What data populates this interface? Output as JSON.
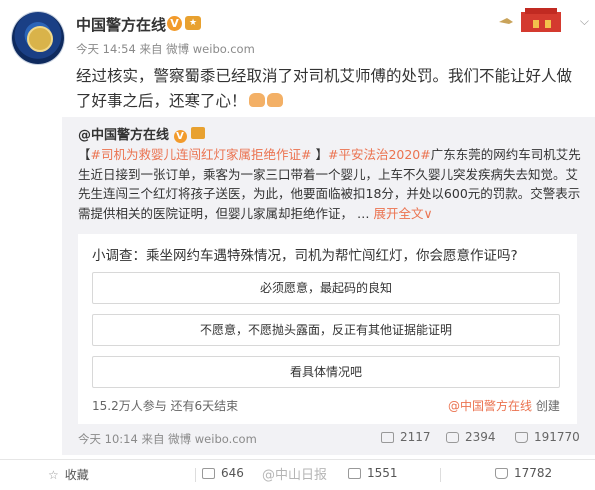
{
  "post": {
    "author": "中国警方在线",
    "verified_badge": "V",
    "meta": "今天 14:54 来自 微博 weibo.com",
    "text": "经过核实，警察蜀黍已经取消了对司机艾师傅的处罚。我们不能让好人做了好事之后，还寒了心！"
  },
  "repost": {
    "author": "@中国警方在线",
    "open_bracket": "【",
    "topic1": "#司机为救婴儿连闯红灯家属拒绝作证#",
    "close_bracket": "】",
    "topic2": "#平安法治2020#",
    "body": "广东东莞的网约车司机艾先生近日接到一张订单，乘客为一家三口带着一个婴儿，上车不久婴儿突发疾病失去知觉。艾先生连闯三个红灯将孩子送医，为此，他要面临被扣18分，并处以600元的罚款。交警表示需提供相关的医院证明，但婴儿家属却拒绝作证，  …",
    "expand": "展开全文",
    "meta": "今天 10:14 来自 微博 weibo.com",
    "reposts": "2117",
    "comments": "2394",
    "likes": "191770"
  },
  "poll": {
    "question": "小调查：乘坐网约车遇特殊情况，司机为帮忙闯红灯，你会愿意作证吗?",
    "options": [
      "必须愿意，最起码的良知",
      "不愿意，不愿抛头露面，反正有其他证据能证明",
      "看具体情况吧"
    ],
    "participants": "15.2万人参与  还有6天结束",
    "creator": "@中国警方在线",
    "creator_suffix": " 创建"
  },
  "bar": {
    "favorite": "收藏",
    "reposts": "646",
    "comments": "1551",
    "likes": "17782",
    "watermark": "@中山日报"
  },
  "colors": {
    "accent": "#eb7350",
    "repost_bg": "#f2f2f5"
  }
}
